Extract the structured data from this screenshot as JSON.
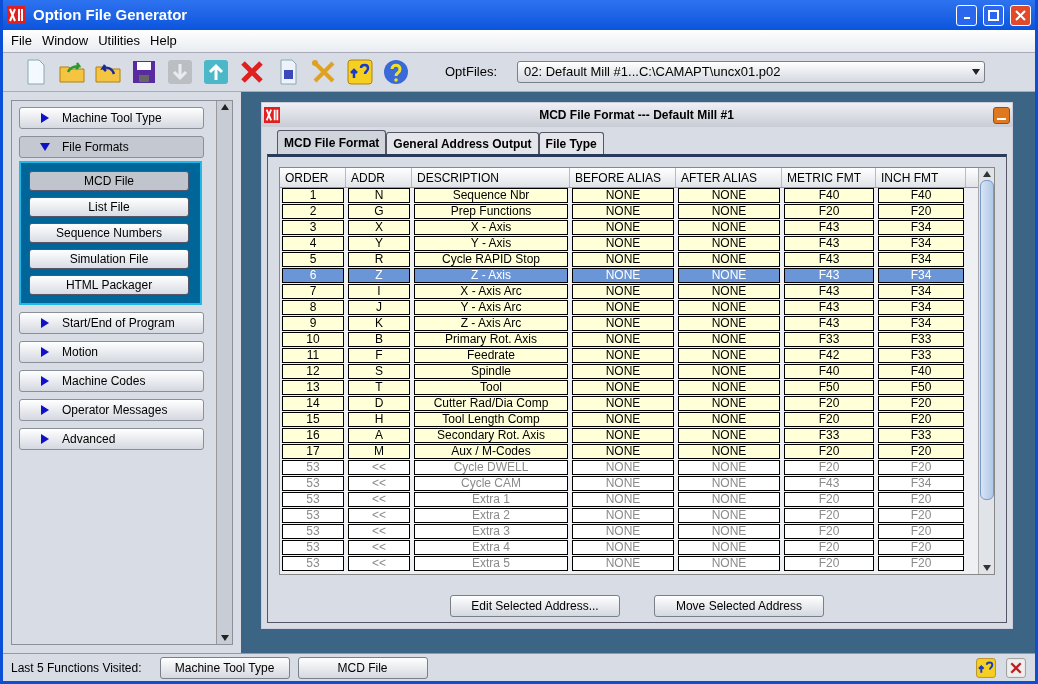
{
  "window": {
    "title": "Option File Generator"
  },
  "menu": [
    "File",
    "Window",
    "Utilities",
    "Help"
  ],
  "toolbar": {
    "optfiles_label": "OptFiles:",
    "optfiles_value": "02:  Default Mill #1...C:\\CAMAPT\\uncx01.p02"
  },
  "sidebar": {
    "items": [
      {
        "label": "Machine Tool Type",
        "expanded": false
      },
      {
        "label": "File Formats",
        "expanded": true,
        "selected": true,
        "children": [
          {
            "label": "MCD File",
            "selected": true
          },
          {
            "label": "List File",
            "selected": false
          },
          {
            "label": "Sequence Numbers",
            "selected": false
          },
          {
            "label": "Simulation File",
            "selected": false
          },
          {
            "label": "HTML Packager",
            "selected": false
          }
        ]
      },
      {
        "label": "Start/End of Program",
        "expanded": false
      },
      {
        "label": "Motion",
        "expanded": false
      },
      {
        "label": "Machine Codes",
        "expanded": false
      },
      {
        "label": "Operator Messages",
        "expanded": false
      },
      {
        "label": "Advanced",
        "expanded": false
      }
    ]
  },
  "frame": {
    "title": "MCD File Format --- Default Mill #1",
    "tabs": [
      {
        "label": "MCD File Format",
        "selected": true
      },
      {
        "label": "General Address Output",
        "selected": false
      },
      {
        "label": "File Type",
        "selected": false
      }
    ],
    "table": {
      "columns": [
        "ORDER",
        "ADDR",
        "DESCRIPTION",
        "BEFORE ALIAS",
        "AFTER ALIAS",
        "METRIC FMT",
        "INCH FMT"
      ],
      "rows": [
        {
          "cells": [
            "1",
            "N",
            "Sequence Nbr",
            "NONE",
            "NONE",
            "F40",
            "F40"
          ],
          "selected": false,
          "disabled": false
        },
        {
          "cells": [
            "2",
            "G",
            "Prep Functions",
            "NONE",
            "NONE",
            "F20",
            "F20"
          ],
          "selected": false,
          "disabled": false
        },
        {
          "cells": [
            "3",
            "X",
            "X - Axis",
            "NONE",
            "NONE",
            "F43",
            "F34"
          ],
          "selected": false,
          "disabled": false
        },
        {
          "cells": [
            "4",
            "Y",
            "Y - Axis",
            "NONE",
            "NONE",
            "F43",
            "F34"
          ],
          "selected": false,
          "disabled": false
        },
        {
          "cells": [
            "5",
            "R",
            "Cycle RAPID Stop",
            "NONE",
            "NONE",
            "F43",
            "F34"
          ],
          "selected": false,
          "disabled": false
        },
        {
          "cells": [
            "6",
            "Z",
            "Z - Axis",
            "NONE",
            "NONE",
            "F43",
            "F34"
          ],
          "selected": true,
          "disabled": false
        },
        {
          "cells": [
            "7",
            "I",
            "X - Axis Arc",
            "NONE",
            "NONE",
            "F43",
            "F34"
          ],
          "selected": false,
          "disabled": false
        },
        {
          "cells": [
            "8",
            "J",
            "Y - Axis Arc",
            "NONE",
            "NONE",
            "F43",
            "F34"
          ],
          "selected": false,
          "disabled": false
        },
        {
          "cells": [
            "9",
            "K",
            "Z - Axis Arc",
            "NONE",
            "NONE",
            "F43",
            "F34"
          ],
          "selected": false,
          "disabled": false
        },
        {
          "cells": [
            "10",
            "B",
            "Primary Rot. Axis",
            "NONE",
            "NONE",
            "F33",
            "F33"
          ],
          "selected": false,
          "disabled": false
        },
        {
          "cells": [
            "11",
            "F",
            "Feedrate",
            "NONE",
            "NONE",
            "F42",
            "F33"
          ],
          "selected": false,
          "disabled": false
        },
        {
          "cells": [
            "12",
            "S",
            "Spindle",
            "NONE",
            "NONE",
            "F40",
            "F40"
          ],
          "selected": false,
          "disabled": false
        },
        {
          "cells": [
            "13",
            "T",
            "Tool",
            "NONE",
            "NONE",
            "F50",
            "F50"
          ],
          "selected": false,
          "disabled": false
        },
        {
          "cells": [
            "14",
            "D",
            "Cutter Rad/Dia Comp",
            "NONE",
            "NONE",
            "F20",
            "F20"
          ],
          "selected": false,
          "disabled": false
        },
        {
          "cells": [
            "15",
            "H",
            "Tool Length Comp",
            "NONE",
            "NONE",
            "F20",
            "F20"
          ],
          "selected": false,
          "disabled": false
        },
        {
          "cells": [
            "16",
            "A",
            "Secondary Rot. Axis",
            "NONE",
            "NONE",
            "F33",
            "F33"
          ],
          "selected": false,
          "disabled": false
        },
        {
          "cells": [
            "17",
            "M",
            "Aux / M-Codes",
            "NONE",
            "NONE",
            "F20",
            "F20"
          ],
          "selected": false,
          "disabled": false
        },
        {
          "cells": [
            "53",
            "<<",
            "Cycle DWELL",
            "NONE",
            "NONE",
            "F20",
            "F20"
          ],
          "selected": false,
          "disabled": true
        },
        {
          "cells": [
            "53",
            "<<",
            "Cycle CAM",
            "NONE",
            "NONE",
            "F43",
            "F34"
          ],
          "selected": false,
          "disabled": true
        },
        {
          "cells": [
            "53",
            "<<",
            "Extra 1",
            "NONE",
            "NONE",
            "F20",
            "F20"
          ],
          "selected": false,
          "disabled": true
        },
        {
          "cells": [
            "53",
            "<<",
            "Extra 2",
            "NONE",
            "NONE",
            "F20",
            "F20"
          ],
          "selected": false,
          "disabled": true
        },
        {
          "cells": [
            "53",
            "<<",
            "Extra 3",
            "NONE",
            "NONE",
            "F20",
            "F20"
          ],
          "selected": false,
          "disabled": true
        },
        {
          "cells": [
            "53",
            "<<",
            "Extra 4",
            "NONE",
            "NONE",
            "F20",
            "F20"
          ],
          "selected": false,
          "disabled": true
        },
        {
          "cells": [
            "53",
            "<<",
            "Extra 5",
            "NONE",
            "NONE",
            "F20",
            "F20"
          ],
          "selected": false,
          "disabled": true
        }
      ]
    },
    "buttons": [
      "Edit Selected Address...",
      "Move Selected Address"
    ]
  },
  "status_bar": {
    "label": "Last 5 Functions Visited:",
    "visited": [
      "Machine Tool Type",
      "MCD File"
    ]
  }
}
